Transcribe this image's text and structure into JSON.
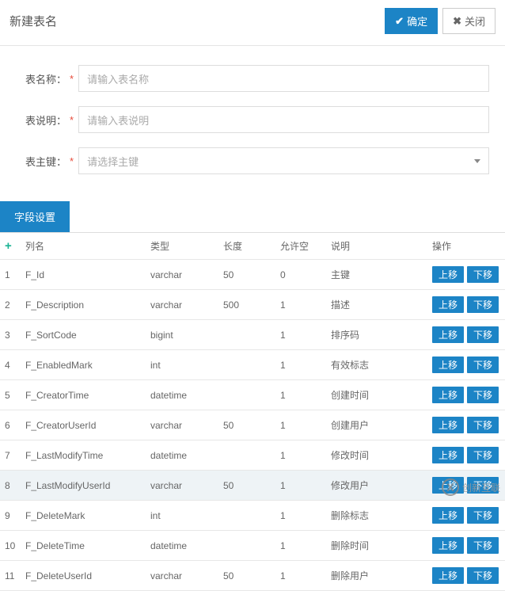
{
  "header": {
    "title": "新建表名",
    "confirm_label": "确定",
    "close_label": "关闭"
  },
  "form": {
    "name_label": "表名称：",
    "name_placeholder": "请输入表名称",
    "desc_label": "表说明：",
    "desc_placeholder": "请输入表说明",
    "pk_label": "表主键：",
    "pk_placeholder": "请选择主键"
  },
  "tabs": {
    "fields": "字段设置"
  },
  "table": {
    "headers": {
      "name": "列名",
      "type": "类型",
      "length": "长度",
      "nullable": "允许空",
      "desc": "说明",
      "ops": "操作"
    },
    "op_up": "上移",
    "op_down": "下移",
    "highlight_index": 8,
    "rows": [
      {
        "idx": "1",
        "name": "F_Id",
        "type": "varchar",
        "length": "50",
        "nullable": "0",
        "desc": "主键"
      },
      {
        "idx": "2",
        "name": "F_Description",
        "type": "varchar",
        "length": "500",
        "nullable": "1",
        "desc": "描述"
      },
      {
        "idx": "3",
        "name": "F_SortCode",
        "type": "bigint",
        "length": "",
        "nullable": "1",
        "desc": "排序码"
      },
      {
        "idx": "4",
        "name": "F_EnabledMark",
        "type": "int",
        "length": "",
        "nullable": "1",
        "desc": "有效标志"
      },
      {
        "idx": "5",
        "name": "F_CreatorTime",
        "type": "datetime",
        "length": "",
        "nullable": "1",
        "desc": "创建时间"
      },
      {
        "idx": "6",
        "name": "F_CreatorUserId",
        "type": "varchar",
        "length": "50",
        "nullable": "1",
        "desc": "创建用户"
      },
      {
        "idx": "7",
        "name": "F_LastModifyTime",
        "type": "datetime",
        "length": "",
        "nullable": "1",
        "desc": "修改时间"
      },
      {
        "idx": "8",
        "name": "F_LastModifyUserId",
        "type": "varchar",
        "length": "50",
        "nullable": "1",
        "desc": "修改用户"
      },
      {
        "idx": "9",
        "name": "F_DeleteMark",
        "type": "int",
        "length": "",
        "nullable": "1",
        "desc": "删除标志"
      },
      {
        "idx": "10",
        "name": "F_DeleteTime",
        "type": "datetime",
        "length": "",
        "nullable": "1",
        "desc": "删除时间"
      },
      {
        "idx": "11",
        "name": "F_DeleteUserId",
        "type": "varchar",
        "length": "50",
        "nullable": "1",
        "desc": "删除用户"
      }
    ]
  },
  "watermark": {
    "logo_text": "X",
    "text": "创新互联"
  }
}
